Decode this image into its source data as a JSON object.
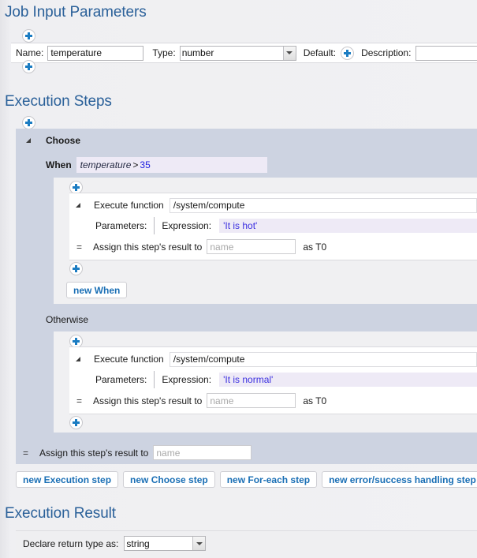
{
  "sections": {
    "job_input": {
      "title": "Job Input Parameters",
      "param": {
        "name_label": "Name:",
        "name_value": "temperature",
        "type_label": "Type:",
        "type_value": "number",
        "type_options": [
          "number"
        ],
        "default_label": "Default:",
        "default_add_icon": "plus-icon",
        "description_label": "Description:",
        "description_value": "",
        "description_placeholder": ""
      },
      "add_before_icon": "plus-icon",
      "add_after_icon": "plus-icon"
    },
    "execution_steps": {
      "title": "Execution Steps",
      "add_icon": "plus-icon",
      "choose": {
        "label": "Choose",
        "collapse_icon": "triangle-collapse-icon",
        "when": {
          "keyword": "When",
          "expr_var": "temperature",
          "expr_op": ">",
          "expr_num": "35",
          "step": {
            "collapse_icon": "triangle-collapse-icon",
            "execute_label": "Execute function",
            "function_path": "/system/compute",
            "parameters_label": "Parameters:",
            "expression_label": "Expression:",
            "expression_value": "'It is hot'",
            "assign_eq": "=",
            "assign_label": "Assign this step's result to",
            "assign_value": "",
            "assign_placeholder": "name",
            "as_label": "as T0"
          },
          "add_top_icon": "plus-icon",
          "add_bottom_icon": "plus-icon",
          "new_when_button": "new When"
        },
        "otherwise": {
          "keyword": "Otherwise",
          "step": {
            "collapse_icon": "triangle-collapse-icon",
            "execute_label": "Execute function",
            "function_path": "/system/compute",
            "parameters_label": "Parameters:",
            "expression_label": "Expression:",
            "expression_value": "'It is normal'",
            "assign_eq": "=",
            "assign_label": "Assign this step's result to",
            "assign_value": "",
            "assign_placeholder": "name",
            "as_label": "as T0"
          },
          "add_top_icon": "plus-icon",
          "add_bottom_icon": "plus-icon"
        },
        "assign_eq": "=",
        "assign_label": "Assign this step's result to",
        "assign_value": "",
        "assign_placeholder": "name"
      },
      "buttons": [
        "new Execution step",
        "new Choose step",
        "new For-each step",
        "new error/success handling step"
      ]
    },
    "execution_result": {
      "title": "Execution Result",
      "return_type_label": "Declare return type as:",
      "return_type_value": "string",
      "return_type_options": [
        "string"
      ]
    }
  },
  "colors": {
    "heading": "#2a6099",
    "accent": "#1b7cc2",
    "choose_bg": "#cdd3e1",
    "expr_bg": "#eeeaf6",
    "expr_string": "#3b2fe0"
  }
}
